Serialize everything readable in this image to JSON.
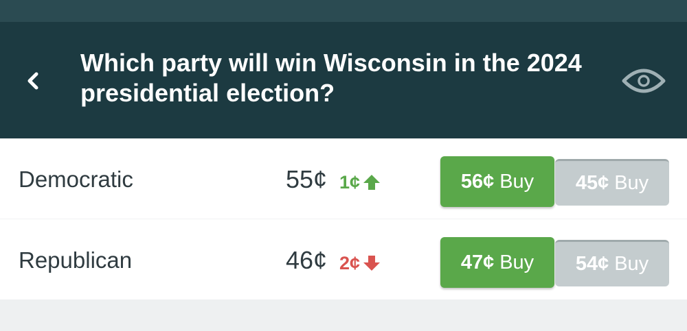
{
  "header": {
    "title": "Which party will win Wisconsin in the 2024 presidential election?",
    "back_icon": "chevron-left-icon",
    "watch_icon": "eye-icon"
  },
  "markets": [
    {
      "name": "Democratic",
      "price": "55¢",
      "change": "1¢",
      "direction": "up",
      "buy_yes_price": "56¢",
      "buy_yes_label": "Buy",
      "buy_no_price": "45¢",
      "buy_no_label": "Buy"
    },
    {
      "name": "Republican",
      "price": "46¢",
      "change": "2¢",
      "direction": "down",
      "buy_yes_price": "47¢",
      "buy_yes_label": "Buy",
      "buy_no_price": "54¢",
      "buy_no_label": "Buy"
    }
  ],
  "colors": {
    "header_bg": "#1c3a41",
    "up": "#5aa84a",
    "down": "#d9534f",
    "buy_yes_bg": "#5aa84a",
    "buy_no_bg": "#c4ccce"
  }
}
